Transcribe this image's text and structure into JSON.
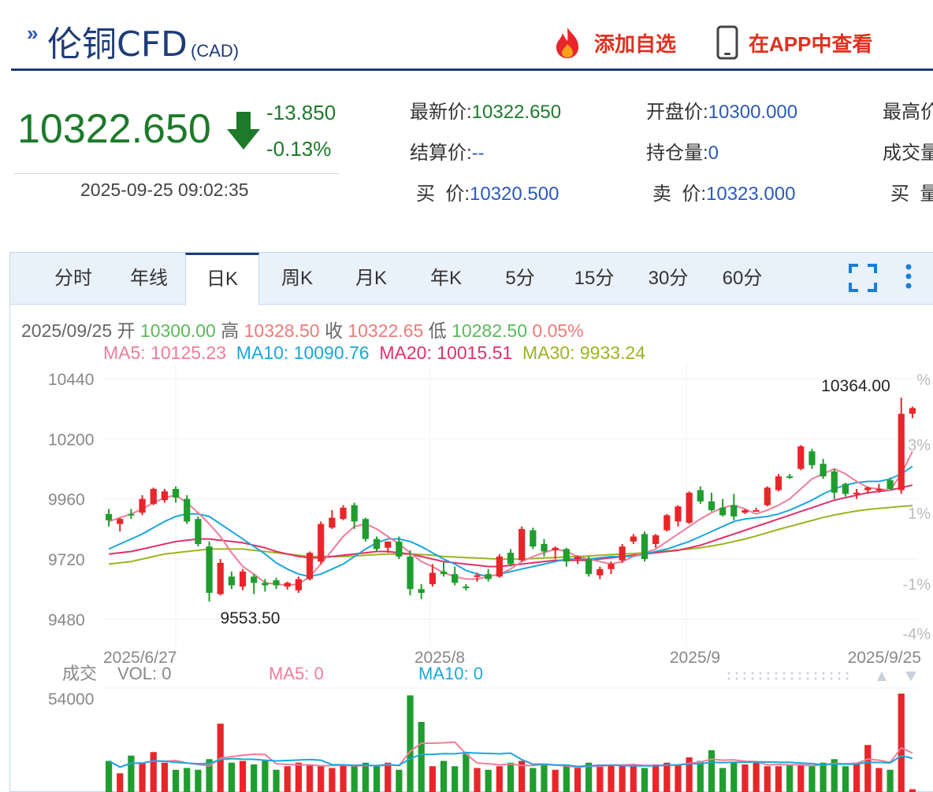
{
  "header": {
    "title": "伦铜CFD",
    "title_sub": "(CAD)",
    "add_fav_label": "添加自选",
    "app_view_label": "在APP中查看"
  },
  "quote": {
    "price": "10322.650",
    "change": "-13.850",
    "change_pct": "-0.13%",
    "time": "2025-09-25 09:02:35"
  },
  "info": {
    "latest_label": "最新价:",
    "latest_value": "10322.650",
    "open_label": "开盘价:",
    "open_value": "10300.000",
    "high_label": "最高价",
    "settle_label": "结算价:",
    "settle_value": "--",
    "oi_label": "持仓量:",
    "oi_value": "0",
    "volume_label": "成交量",
    "bid_label": "买  价:",
    "bid_value": "10320.500",
    "ask_label": "卖  价:",
    "ask_value": "10323.000",
    "bidvol_label": "买  量"
  },
  "tabs": [
    "分时",
    "年线",
    "日K",
    "周K",
    "月K",
    "年K",
    "5分",
    "15分",
    "30分",
    "60分"
  ],
  "active_tab": "日K",
  "colors": {
    "up": "#e8262a",
    "down": "#1f9d2f",
    "ma5": "#f07c9a",
    "ma10": "#1aa7dd",
    "ma20": "#e0306a",
    "ma30": "#9cb321",
    "accent": "#1e3c78"
  },
  "chart_data": {
    "type": "candlestick",
    "ohlc_bar": {
      "date": "2025/09/25",
      "open_label": "开",
      "open": "10300.00",
      "high_label": "高",
      "high": "10328.50",
      "close_label": "收",
      "close": "10322.65",
      "low_label": "低",
      "low": "10282.50",
      "pct": "0.05%"
    },
    "ma_legend": [
      {
        "label": "MA5: ",
        "value": "10125.23"
      },
      {
        "label": "MA10: ",
        "value": "10090.76"
      },
      {
        "label": "MA20: ",
        "value": "10015.51"
      },
      {
        "label": "MA30: ",
        "value": "9933.24"
      }
    ],
    "y_ticks": [
      "10440",
      "10200",
      "9960",
      "9720",
      "9480"
    ],
    "y_range": [
      9450,
      10440
    ],
    "pct_ticks": [
      "%",
      "3%",
      "1%",
      "-1%",
      "-4%"
    ],
    "x_labels": [
      "2025/6/27",
      "2025/8",
      "2025/9",
      "2025/9/25"
    ],
    "max_label": "10364.00",
    "min_label": "9553.50",
    "candles": [
      {
        "o": 9900,
        "h": 9920,
        "l": 9850,
        "c": 9875
      },
      {
        "o": 9860,
        "h": 9885,
        "l": 9830,
        "c": 9880
      },
      {
        "o": 9900,
        "h": 9920,
        "l": 9880,
        "c": 9895
      },
      {
        "o": 9905,
        "h": 9975,
        "l": 9895,
        "c": 9960
      },
      {
        "o": 9940,
        "h": 10005,
        "l": 9935,
        "c": 10000
      },
      {
        "o": 9955,
        "h": 10000,
        "l": 9945,
        "c": 9990
      },
      {
        "o": 10000,
        "h": 10010,
        "l": 9945,
        "c": 9965
      },
      {
        "o": 9960,
        "h": 9975,
        "l": 9860,
        "c": 9870
      },
      {
        "o": 9880,
        "h": 9890,
        "l": 9770,
        "c": 9780
      },
      {
        "o": 9770,
        "h": 9790,
        "l": 9550,
        "c": 9585
      },
      {
        "o": 9580,
        "h": 9720,
        "l": 9575,
        "c": 9705
      },
      {
        "o": 9650,
        "h": 9670,
        "l": 9600,
        "c": 9615
      },
      {
        "o": 9610,
        "h": 9680,
        "l": 9595,
        "c": 9670
      },
      {
        "o": 9650,
        "h": 9660,
        "l": 9580,
        "c": 9625
      },
      {
        "o": 9625,
        "h": 9640,
        "l": 9590,
        "c": 9615
      },
      {
        "o": 9635,
        "h": 9645,
        "l": 9600,
        "c": 9615
      },
      {
        "o": 9610,
        "h": 9630,
        "l": 9598,
        "c": 9625
      },
      {
        "o": 9595,
        "h": 9650,
        "l": 9585,
        "c": 9640
      },
      {
        "o": 9640,
        "h": 9750,
        "l": 9635,
        "c": 9745
      },
      {
        "o": 9710,
        "h": 9870,
        "l": 9700,
        "c": 9860
      },
      {
        "o": 9845,
        "h": 9915,
        "l": 9840,
        "c": 9885
      },
      {
        "o": 9880,
        "h": 9935,
        "l": 9875,
        "c": 9925
      },
      {
        "o": 9935,
        "h": 9945,
        "l": 9840,
        "c": 9870
      },
      {
        "o": 9880,
        "h": 9885,
        "l": 9790,
        "c": 9800
      },
      {
        "o": 9800,
        "h": 9810,
        "l": 9750,
        "c": 9760
      },
      {
        "o": 9765,
        "h": 9790,
        "l": 9745,
        "c": 9790
      },
      {
        "o": 9790,
        "h": 9810,
        "l": 9720,
        "c": 9730
      },
      {
        "o": 9730,
        "h": 9755,
        "l": 9575,
        "c": 9600
      },
      {
        "o": 9600,
        "h": 9620,
        "l": 9560,
        "c": 9585
      },
      {
        "o": 9620,
        "h": 9700,
        "l": 9610,
        "c": 9665
      },
      {
        "o": 9670,
        "h": 9710,
        "l": 9650,
        "c": 9660
      },
      {
        "o": 9660,
        "h": 9690,
        "l": 9615,
        "c": 9625
      },
      {
        "o": 9610,
        "h": 9620,
        "l": 9595,
        "c": 9605
      },
      {
        "o": 9650,
        "h": 9665,
        "l": 9630,
        "c": 9655
      },
      {
        "o": 9660,
        "h": 9680,
        "l": 9630,
        "c": 9640
      },
      {
        "o": 9650,
        "h": 9740,
        "l": 9645,
        "c": 9730
      },
      {
        "o": 9745,
        "h": 9760,
        "l": 9690,
        "c": 9700
      },
      {
        "o": 9715,
        "h": 9850,
        "l": 9710,
        "c": 9840
      },
      {
        "o": 9835,
        "h": 9845,
        "l": 9760,
        "c": 9770
      },
      {
        "o": 9780,
        "h": 9800,
        "l": 9730,
        "c": 9750
      },
      {
        "o": 9755,
        "h": 9770,
        "l": 9720,
        "c": 9765
      },
      {
        "o": 9760,
        "h": 9765,
        "l": 9690,
        "c": 9710
      },
      {
        "o": 9720,
        "h": 9735,
        "l": 9700,
        "c": 9730
      },
      {
        "o": 9720,
        "h": 9730,
        "l": 9650,
        "c": 9660
      },
      {
        "o": 9655,
        "h": 9690,
        "l": 9640,
        "c": 9680
      },
      {
        "o": 9680,
        "h": 9710,
        "l": 9660,
        "c": 9700
      },
      {
        "o": 9715,
        "h": 9780,
        "l": 9705,
        "c": 9770
      },
      {
        "o": 9790,
        "h": 9820,
        "l": 9780,
        "c": 9810
      },
      {
        "o": 9820,
        "h": 9830,
        "l": 9710,
        "c": 9720
      },
      {
        "o": 9780,
        "h": 9820,
        "l": 9765,
        "c": 9815
      },
      {
        "o": 9835,
        "h": 9900,
        "l": 9830,
        "c": 9895
      },
      {
        "o": 9870,
        "h": 9935,
        "l": 9850,
        "c": 9930
      },
      {
        "o": 9865,
        "h": 9990,
        "l": 9860,
        "c": 9985
      },
      {
        "o": 9995,
        "h": 10010,
        "l": 9940,
        "c": 9950
      },
      {
        "o": 9950,
        "h": 9985,
        "l": 9910,
        "c": 9915
      },
      {
        "o": 9925,
        "h": 9960,
        "l": 9890,
        "c": 9895
      },
      {
        "o": 9935,
        "h": 9980,
        "l": 9875,
        "c": 9890
      },
      {
        "o": 9905,
        "h": 9920,
        "l": 9900,
        "c": 9915
      },
      {
        "o": 9915,
        "h": 9925,
        "l": 9910,
        "c": 9915
      },
      {
        "o": 9935,
        "h": 10010,
        "l": 9930,
        "c": 10005
      },
      {
        "o": 9995,
        "h": 10060,
        "l": 9990,
        "c": 10050
      },
      {
        "o": 10050,
        "h": 10060,
        "l": 10040,
        "c": 10045
      },
      {
        "o": 10080,
        "h": 10175,
        "l": 10075,
        "c": 10170
      },
      {
        "o": 10150,
        "h": 10160,
        "l": 10080,
        "c": 10095
      },
      {
        "o": 10100,
        "h": 10120,
        "l": 10040,
        "c": 10050
      },
      {
        "o": 10070,
        "h": 10080,
        "l": 9960,
        "c": 9985
      },
      {
        "o": 10020,
        "h": 10025,
        "l": 9970,
        "c": 9980
      },
      {
        "o": 9985,
        "h": 10000,
        "l": 9960,
        "c": 9985
      },
      {
        "o": 9995,
        "h": 10010,
        "l": 9980,
        "c": 10005
      },
      {
        "o": 10000,
        "h": 10020,
        "l": 9985,
        "c": 10000
      },
      {
        "o": 10035,
        "h": 10045,
        "l": 9995,
        "c": 10000
      },
      {
        "o": 9995,
        "h": 10364,
        "l": 9980,
        "c": 10300
      },
      {
        "o": 10300,
        "h": 10328.5,
        "l": 10282.5,
        "c": 10322.65
      }
    ],
    "ma_series": {
      "ma5": [
        9870,
        9885,
        9900,
        9920,
        9945,
        9965,
        9975,
        9945,
        9905,
        9860,
        9810,
        9745,
        9690,
        9660,
        9625,
        9620,
        9615,
        9620,
        9650,
        9700,
        9755,
        9810,
        9850,
        9860,
        9840,
        9810,
        9780,
        9745,
        9710,
        9690,
        9665,
        9650,
        9640,
        9640,
        9650,
        9660,
        9680,
        9710,
        9730,
        9745,
        9760,
        9750,
        9730,
        9720,
        9710,
        9700,
        9710,
        9730,
        9745,
        9760,
        9790,
        9820,
        9850,
        9880,
        9905,
        9925,
        9935,
        9920,
        9900,
        9915,
        9935,
        9960,
        10000,
        10040,
        10060,
        10080,
        10060,
        10030,
        10005,
        10000,
        9995,
        10060,
        10150
      ],
      "ma10": [
        9760,
        9780,
        9800,
        9820,
        9845,
        9870,
        9890,
        9900,
        9900,
        9890,
        9860,
        9830,
        9800,
        9770,
        9740,
        9705,
        9680,
        9660,
        9650,
        9660,
        9680,
        9700,
        9730,
        9760,
        9785,
        9800,
        9800,
        9790,
        9770,
        9745,
        9720,
        9700,
        9675,
        9660,
        9650,
        9660,
        9670,
        9680,
        9690,
        9700,
        9710,
        9720,
        9720,
        9720,
        9725,
        9730,
        9730,
        9730,
        9740,
        9750,
        9760,
        9775,
        9790,
        9810,
        9830,
        9850,
        9870,
        9880,
        9885,
        9890,
        9900,
        9915,
        9935,
        9955,
        9980,
        10000,
        10015,
        10025,
        10030,
        10030,
        10040,
        10060,
        10090
      ],
      "ma20": [
        9740,
        9745,
        9750,
        9760,
        9770,
        9780,
        9790,
        9795,
        9800,
        9800,
        9795,
        9790,
        9785,
        9775,
        9765,
        9750,
        9740,
        9730,
        9725,
        9725,
        9730,
        9735,
        9740,
        9745,
        9750,
        9750,
        9745,
        9740,
        9730,
        9720,
        9710,
        9705,
        9700,
        9695,
        9690,
        9690,
        9695,
        9700,
        9705,
        9710,
        9715,
        9715,
        9715,
        9715,
        9720,
        9725,
        9730,
        9735,
        9740,
        9745,
        9750,
        9755,
        9765,
        9775,
        9790,
        9805,
        9820,
        9835,
        9850,
        9865,
        9880,
        9895,
        9910,
        9925,
        9940,
        9955,
        9965,
        9975,
        9985,
        9990,
        9995,
        10005,
        10015
      ],
      "ma30": [
        9700,
        9705,
        9710,
        9720,
        9730,
        9740,
        9745,
        9750,
        9755,
        9760,
        9760,
        9760,
        9760,
        9755,
        9750,
        9745,
        9740,
        9735,
        9730,
        9730,
        9730,
        9730,
        9732,
        9735,
        9738,
        9740,
        9740,
        9740,
        9738,
        9735,
        9730,
        9728,
        9726,
        9724,
        9722,
        9720,
        9720,
        9720,
        9722,
        9724,
        9726,
        9728,
        9730,
        9732,
        9735,
        9738,
        9740,
        9742,
        9745,
        9748,
        9752,
        9756,
        9760,
        9765,
        9772,
        9780,
        9790,
        9800,
        9812,
        9825,
        9838,
        9850,
        9862,
        9874,
        9886,
        9896,
        9904,
        9912,
        9918,
        9922,
        9926,
        9930,
        9933
      ]
    },
    "volume_legend": {
      "title": "成交",
      "vol_label": "VOL: ",
      "vol_value": "0",
      "ma5_label": "MA5: ",
      "ma5_value": "0",
      "ma10_label": "MA10: ",
      "ma10_value": "0"
    },
    "volume_max_label": "54000",
    "volume": [
      18000,
      11000,
      21000,
      17000,
      23000,
      17000,
      13000,
      14000,
      13000,
      19000,
      39000,
      17000,
      18000,
      16000,
      18000,
      13000,
      15000,
      17000,
      16000,
      15000,
      14000,
      16000,
      15000,
      17000,
      15000,
      17000,
      13000,
      55000,
      40000,
      15000,
      18000,
      15000,
      22000,
      14000,
      13000,
      15000,
      17000,
      18000,
      14000,
      16000,
      13000,
      15000,
      14000,
      17000,
      16000,
      16000,
      15000,
      16000,
      14000,
      16000,
      17000,
      16000,
      20000,
      18000,
      24000,
      14000,
      17000,
      16000,
      17000,
      15000,
      15000,
      16000,
      16000,
      15000,
      17000,
      19000,
      15000,
      17000,
      27000,
      14000,
      13000,
      56000,
      2000
    ]
  }
}
